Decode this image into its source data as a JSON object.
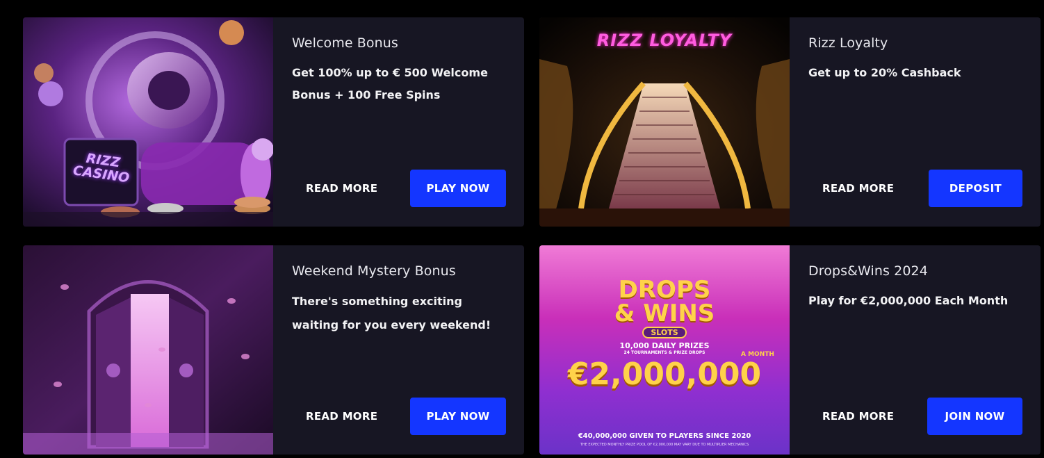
{
  "promos": [
    {
      "title": "Welcome Bonus",
      "description": "Get 100% up to € 500 Welcome Bonus + 100 Free Spins",
      "read_more": "READ MORE",
      "cta": "PLAY NOW",
      "image_icon": "casino-vault-image",
      "image_text": "RIZZ CASINO"
    },
    {
      "title": "Rizz Loyalty",
      "description": "Get up to 20% Cashback",
      "read_more": "READ MORE",
      "cta": "DEPOSIT",
      "image_icon": "golden-staircase-image",
      "image_text": "RIZZ LOYALTY"
    },
    {
      "title": "Weekend Mystery Bonus",
      "description": "There's something exciting waiting for you every weekend!",
      "read_more": "READ MORE",
      "cta": "PLAY NOW",
      "image_icon": "mystery-door-image",
      "image_text": ""
    },
    {
      "title": "Drops&Wins 2024",
      "description": "Play for €2,000,000 Each Month",
      "read_more": "READ MORE",
      "cta": "JOIN NOW",
      "image_icon": "drops-wins-banner-image",
      "banner": {
        "headline_1": "DROPS",
        "headline_2": "& WINS",
        "badge": "SLOTS",
        "daily_prizes": "10,000 DAILY PRIZES",
        "sub": "24 TOURNAMENTS & PRIZE DROPS",
        "a_month": "A MONTH",
        "amount": "€2,000,000",
        "given": "€40,000,000 GIVEN TO PLAYERS SINCE 2020",
        "fine_print": "THE EXPECTED MONTHLY PRIZE POOL OF €2,000,000 MAY VARY DUE TO MULTIPLIER MECHANICS"
      }
    }
  ],
  "colors": {
    "page_bg": "#000000",
    "card_bg": "#171623",
    "cta_bg": "#1436ff",
    "text": "#ffffff"
  }
}
